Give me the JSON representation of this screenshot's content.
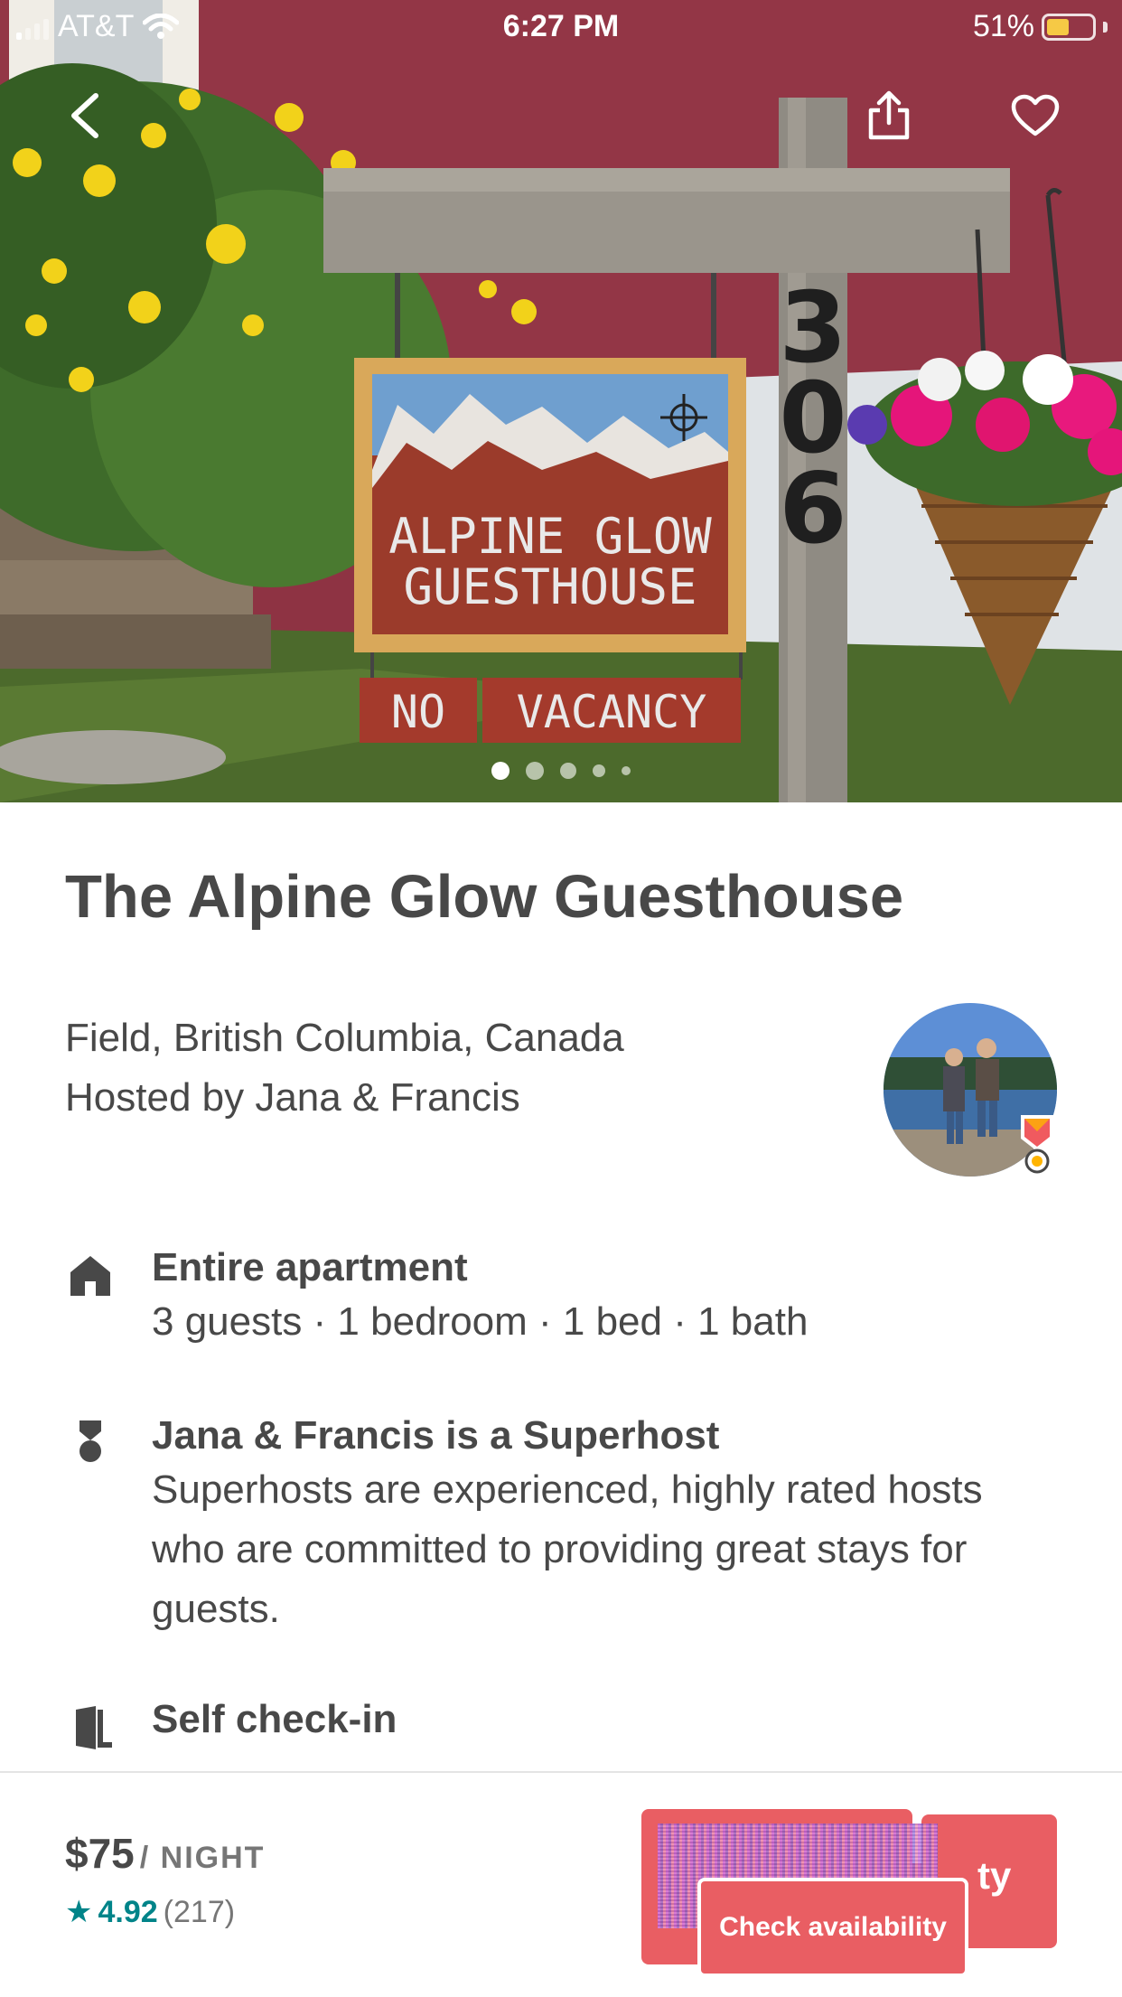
{
  "status_bar": {
    "carrier": "AT&T",
    "time": "6:27 PM",
    "battery": "51%",
    "battery_level": 0.51
  },
  "hero": {
    "sign_line1": "ALPINE GLOW",
    "sign_line2": "GUESTHOUSE",
    "sign_no": "NO",
    "sign_vacancy": "VACANCY",
    "house_number": "306",
    "photo_count": 5,
    "active_photo": 1
  },
  "listing": {
    "title": "The Alpine Glow Guesthouse",
    "location": "Field, British Columbia, Canada",
    "host_line": "Hosted by Jana & Francis"
  },
  "features": [
    {
      "icon": "house-icon",
      "heading": "Entire apartment",
      "sub": "3 guests · 1 bedroom · 1 bed · 1 bath"
    },
    {
      "icon": "superhost-icon",
      "heading": "Jana & Francis is a Superhost",
      "sub": "Superhosts are experienced, highly rated hosts who are committed to providing great stays for guests."
    },
    {
      "icon": "door-icon",
      "heading": "Self check-in",
      "sub": ""
    }
  ],
  "booking": {
    "price": "$75",
    "unit": "/ NIGHT",
    "rating": "4.92",
    "review_count": "(217)",
    "ghost_fragment": "ty",
    "button_label": "Check availability"
  },
  "colors": {
    "accent": "#e95e63",
    "teal": "#008489",
    "text": "#484848"
  }
}
